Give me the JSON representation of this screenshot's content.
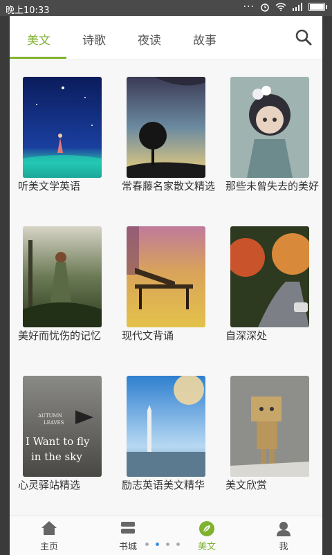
{
  "status": {
    "time": "晚上10:33",
    "icons": [
      "more-icon",
      "alarm-icon",
      "wifi-icon",
      "signal-icon",
      "battery-icon"
    ]
  },
  "tabs": [
    {
      "label": "美文",
      "active": true
    },
    {
      "label": "诗歌",
      "active": false
    },
    {
      "label": "夜读",
      "active": false
    },
    {
      "label": "故事",
      "active": false
    }
  ],
  "colors": {
    "accent": "#7fb22f"
  },
  "books": [
    {
      "title": "听美文学英语"
    },
    {
      "title": "常春藤名家散文精选"
    },
    {
      "title": "那些未曾失去的美好"
    },
    {
      "title": "美好而忧伤的记忆"
    },
    {
      "title": "现代文背诵"
    },
    {
      "title": "自深深处"
    },
    {
      "title": "心灵驿站精选",
      "cover_text": [
        "AUTUMN",
        "LEAVES",
        "I Want to fly",
        "in the sky"
      ]
    },
    {
      "title": "励志英语美文精华"
    },
    {
      "title": "美文欣赏"
    }
  ],
  "nav": [
    {
      "label": "主页",
      "icon": "home-icon"
    },
    {
      "label": "书城",
      "icon": "bookstore-icon"
    },
    {
      "label": "美文",
      "icon": "leaf-icon",
      "active": true
    },
    {
      "label": "我",
      "icon": "person-icon"
    }
  ]
}
